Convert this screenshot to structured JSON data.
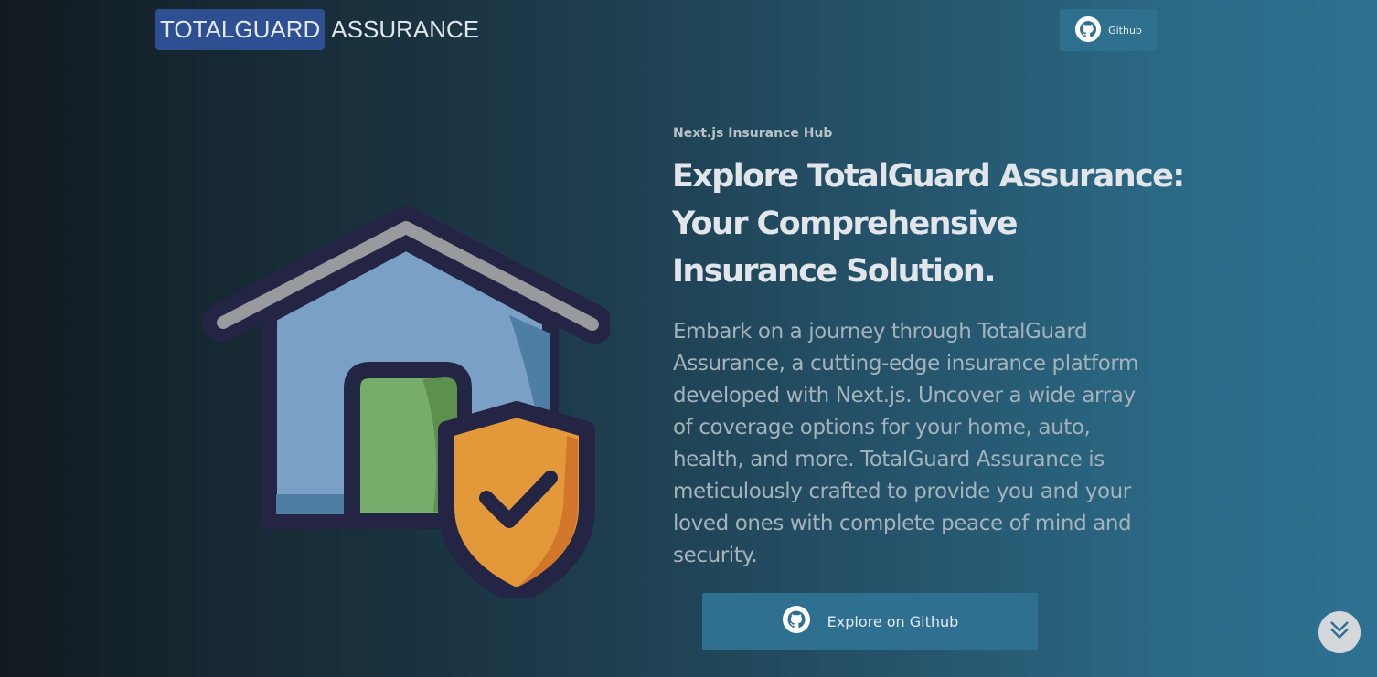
{
  "header": {
    "logo_highlight": "TOTALGUARD",
    "logo_rest": "ASSURANCE",
    "github_label": "Github"
  },
  "hero": {
    "eyebrow": "Next.js Insurance Hub",
    "title": "Explore TotalGuard Assurance: Your Comprehensive Insurance Solution.",
    "description": "Embark on a journey through TotalGuard Assurance, a cutting-edge insurance platform developed with Next.js. Uncover a wide array of coverage options for your home, auto, health, and more. TotalGuard Assurance is meticulously crafted to provide you and your loved ones with complete peace of mind and security.",
    "cta_label": "Explore on Github"
  },
  "icons": {
    "github": "github-icon",
    "illustration": "house-shield-icon",
    "scroll": "chevrons-down-icon"
  },
  "colors": {
    "logo_bg": "#2f4f93",
    "button_bg": "#30708f",
    "shield": "#e3983a",
    "house": "#7aa0c6",
    "door": "#76ad6a"
  }
}
